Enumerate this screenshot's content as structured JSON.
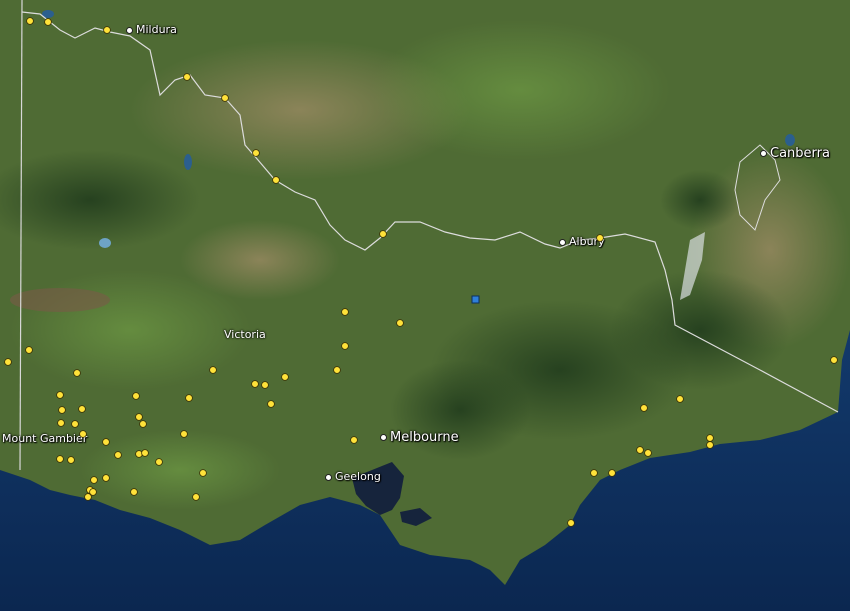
{
  "map": {
    "imagery": "satellite",
    "colors": {
      "land_light": "#5d7a3c",
      "land_dark": "#2e4a24",
      "land_dry": "#8a8058",
      "ocean": "#0f3468",
      "border": "#d8d8d8",
      "marker_fill": "#ffe23a",
      "marker_stroke": "#3a3000",
      "selected_marker": "#2f7fd9"
    },
    "labels": {
      "mildura": "Mildura",
      "canberra": "Canberra",
      "albury": "Albury",
      "victoria": "Victoria",
      "mount_gambier": "Mount Gambier",
      "melbourne": "Melbourne",
      "geelong": "Geelong"
    },
    "marker_count": 66,
    "selected_marker_count": 1
  }
}
